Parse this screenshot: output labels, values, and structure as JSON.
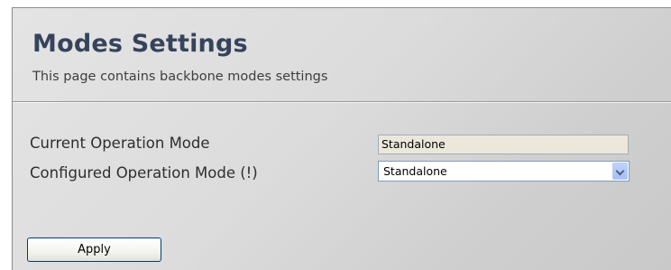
{
  "page": {
    "title": "Modes Settings",
    "subtitle": "This page contains backbone modes settings"
  },
  "fields": {
    "current_mode": {
      "label": "Current Operation Mode",
      "value": "Standalone"
    },
    "configured_mode": {
      "label": "Configured Operation Mode (!)",
      "selected": "Standalone"
    }
  },
  "actions": {
    "apply_label": "Apply"
  },
  "icons": {
    "dropdown": "chevron-down-icon"
  }
}
